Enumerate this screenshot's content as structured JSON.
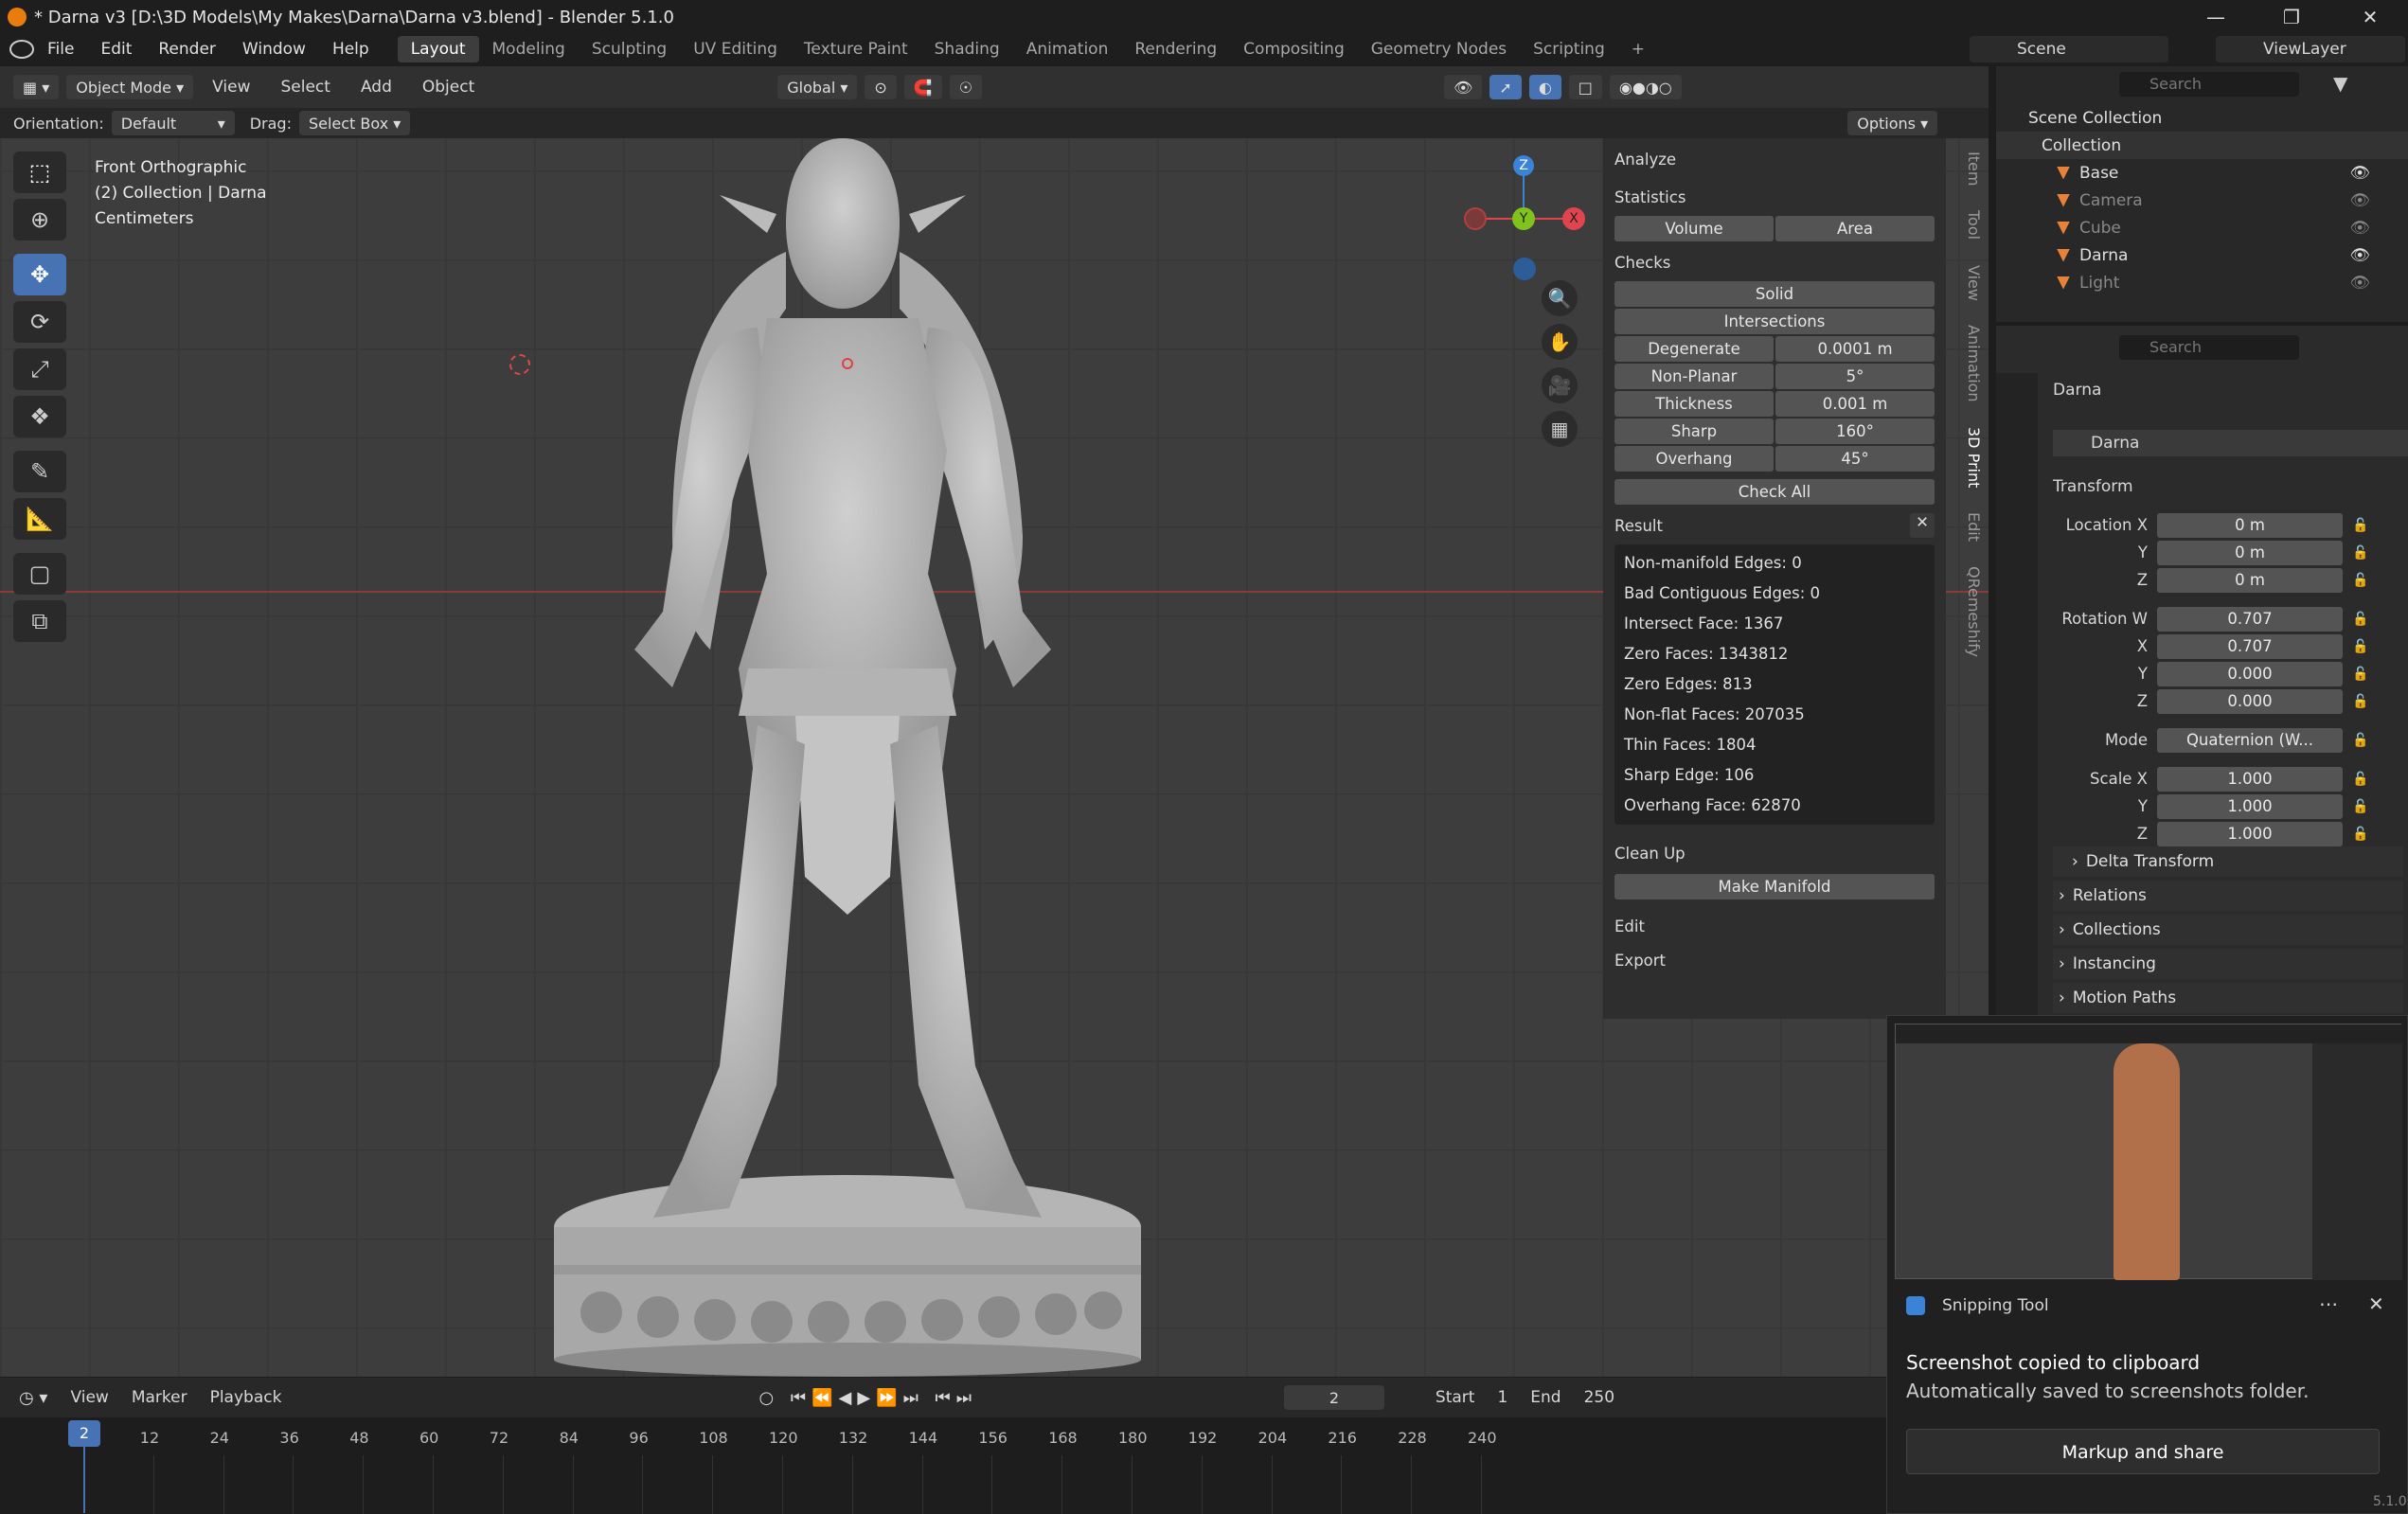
{
  "window": {
    "title": "* Darna v3 [D:\\3D Models\\My Makes\\Darna\\Darna v3.blend] - Blender 5.1.0"
  },
  "menu": [
    "File",
    "Edit",
    "Render",
    "Window",
    "Help"
  ],
  "workspaces": [
    "Layout",
    "Modeling",
    "Sculpting",
    "UV Editing",
    "Texture Paint",
    "Shading",
    "Animation",
    "Rendering",
    "Compositing",
    "Geometry Nodes",
    "Scripting"
  ],
  "scene": "Scene",
  "view_layer": "ViewLayer",
  "viewport_header": {
    "mode": "Object Mode",
    "view": "View",
    "select": "Select",
    "add": "Add",
    "object": "Object",
    "transform": "Global"
  },
  "tool_settings": {
    "orientation_label": "Orientation:",
    "orientation_value": "Default",
    "drag_label": "Drag:",
    "drag_value": "Select Box",
    "options": "Options"
  },
  "overlay_text": {
    "line1": "Front Orthographic",
    "line2": "(2) Collection | Darna",
    "line3": "Centimeters"
  },
  "gizmo": {
    "z": "Z",
    "y": "Y",
    "x": "X"
  },
  "npanel": {
    "analyze": "Analyze",
    "statistics": "Statistics",
    "volume": "Volume",
    "area": "Area",
    "checks": "Checks",
    "solid": "Solid",
    "intersections": "Intersections",
    "checks_rows": [
      {
        "label": "Degenerate",
        "value": "0.0001 m"
      },
      {
        "label": "Non-Planar",
        "value": "5°"
      },
      {
        "label": "Thickness",
        "value": "0.001 m"
      },
      {
        "label": "Sharp",
        "value": "160°"
      },
      {
        "label": "Overhang",
        "value": "45°"
      }
    ],
    "check_all": "Check All",
    "result": "Result",
    "results": [
      "Non-manifold Edges: 0",
      "Bad Contiguous Edges: 0",
      "Intersect Face: 1367",
      "Zero Faces: 1343812",
      "Zero Edges: 813",
      "Non-flat Faces: 207035",
      "Thin Faces: 1804",
      "Sharp Edge: 106",
      "Overhang Face: 62870"
    ],
    "clean_up": "Clean Up",
    "make_manifold": "Make Manifold",
    "edit": "Edit",
    "export": "Export",
    "tabs": [
      "Item",
      "Tool",
      "View",
      "Animation",
      "3D Print",
      "Edit",
      "QRemeshify"
    ]
  },
  "outliner": {
    "search_placeholder": "Search",
    "root": "Scene Collection",
    "collection": "Collection",
    "items": [
      "Base",
      "Camera",
      "Cube",
      "Darna",
      "Light"
    ]
  },
  "properties": {
    "search_placeholder": "Search",
    "object": "Darna",
    "data": "Darna",
    "transform": "Transform",
    "location": {
      "label": "Location X",
      "y": "Y",
      "z": "Z",
      "x_val": "0 m",
      "y_val": "0 m",
      "z_val": "0 m"
    },
    "rotation": {
      "label": "Rotation W",
      "x": "X",
      "y": "Y",
      "z": "Z",
      "w_val": "0.707",
      "x_val": "0.707",
      "y_val": "0.000",
      "z_val": "0.000"
    },
    "mode_label": "Mode",
    "mode_value": "Quaternion (W...",
    "scale": {
      "label": "Scale X",
      "y": "Y",
      "z": "Z",
      "x_val": "1.000",
      "y_val": "1.000",
      "z_val": "1.000"
    },
    "sections": [
      "Delta Transform",
      "Relations",
      "Collections",
      "Instancing",
      "Motion Paths"
    ]
  },
  "timeline": {
    "view": "View",
    "marker": "Marker",
    "playback": "Playback",
    "current": "2",
    "start_label": "Start",
    "start": "1",
    "end_label": "End",
    "end": "250",
    "ticks": [
      "12",
      "24",
      "36",
      "48",
      "60",
      "72",
      "84",
      "96",
      "108",
      "120",
      "132",
      "144",
      "156",
      "168",
      "180",
      "192",
      "204",
      "216",
      "228",
      "240"
    ]
  },
  "toast": {
    "app": "Snipping Tool",
    "title": "Screenshot copied to clipboard",
    "body": "Automatically saved to screenshots folder.",
    "button": "Markup and share"
  },
  "version": "5.1.0",
  "colors": {
    "accent": "#4772b3",
    "x_axis": "#e0444e",
    "y_axis": "#7fc31c",
    "z_axis": "#3b83d6",
    "viewport": "#3d3d3d"
  }
}
